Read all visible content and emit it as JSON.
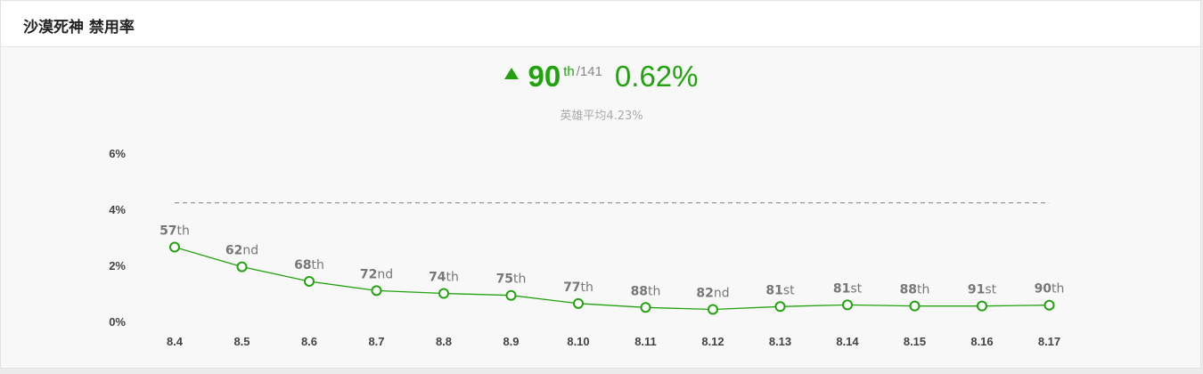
{
  "header": {
    "title": "沙漠死神 禁用率"
  },
  "summary": {
    "rank": "90",
    "rank_suffix": "th",
    "rank_total": "/141",
    "rate": "0.62%",
    "average_text": "英雄平均4.23%",
    "trend": "up",
    "accent_color": "#22a20f"
  },
  "chart_data": {
    "type": "line",
    "title": "",
    "xlabel": "",
    "ylabel": "",
    "categories": [
      "8.4",
      "8.5",
      "8.6",
      "8.7",
      "8.8",
      "8.9",
      "8.10",
      "8.11",
      "8.12",
      "8.13",
      "8.14",
      "8.15",
      "8.16",
      "8.17"
    ],
    "series": [
      {
        "values": [
          2.65,
          1.95,
          1.43,
          1.1,
          1.0,
          0.93,
          0.64,
          0.5,
          0.43,
          0.53,
          0.59,
          0.55,
          0.55,
          0.58
        ],
        "ranks": [
          {
            "num": "57",
            "suffix": "th"
          },
          {
            "num": "62",
            "suffix": "nd"
          },
          {
            "num": "68",
            "suffix": "th"
          },
          {
            "num": "72",
            "suffix": "nd"
          },
          {
            "num": "74",
            "suffix": "th"
          },
          {
            "num": "75",
            "suffix": "th"
          },
          {
            "num": "77",
            "suffix": "th"
          },
          {
            "num": "88",
            "suffix": "th"
          },
          {
            "num": "82",
            "suffix": "nd"
          },
          {
            "num": "81",
            "suffix": "st"
          },
          {
            "num": "81",
            "suffix": "st"
          },
          {
            "num": "88",
            "suffix": "th"
          },
          {
            "num": "91",
            "suffix": "st"
          },
          {
            "num": "90",
            "suffix": "th"
          }
        ],
        "color": "#22a20f"
      }
    ],
    "reference_line": {
      "value": 4.23,
      "style": "dashed",
      "color": "#999999"
    },
    "y_ticks": [
      {
        "value": 0,
        "label": "0%"
      },
      {
        "value": 2,
        "label": "2%"
      },
      {
        "value": 4,
        "label": "4%"
      },
      {
        "value": 6,
        "label": "6%"
      }
    ],
    "ylim": [
      0,
      6
    ],
    "grid": false,
    "legend": "none"
  }
}
